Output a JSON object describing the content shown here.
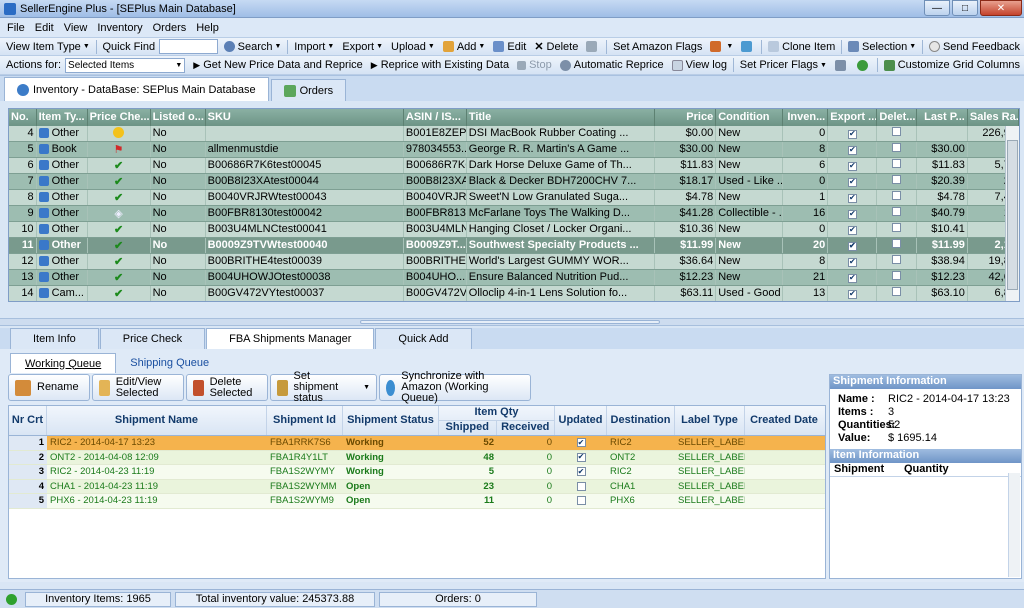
{
  "app": {
    "title": "SellerEngine Plus - [SEPlus Main Database]"
  },
  "menu": [
    "File",
    "Edit",
    "View",
    "Inventory",
    "Orders",
    "Help"
  ],
  "toolbar1": {
    "view_item_type": "View Item Type",
    "quick_find": "Quick Find",
    "search": "Search",
    "import": "Import",
    "export": "Export",
    "upload": "Upload",
    "add": "Add",
    "edit": "Edit",
    "delete": "Delete",
    "set_amazon_flags": "Set Amazon Flags",
    "clone_item": "Clone Item",
    "selection": "Selection",
    "send_feedback": "Send Feedback"
  },
  "toolbar2": {
    "actions_for": "Actions for:",
    "selected_items": "Selected Items",
    "get_new_price": "Get New Price Data and Reprice",
    "reprice_existing": "Reprice with Existing Data",
    "stop": "Stop",
    "automatic_reprice": "Automatic Reprice",
    "view_log": "View log",
    "set_pricer_flags": "Set Pricer Flags",
    "customize_grid": "Customize Grid Columns"
  },
  "main_tabs": [
    "Inventory - DataBase: SEPlus Main Database",
    "Orders"
  ],
  "grid": {
    "headers": [
      "No.",
      "Item Ty...",
      "Price Che...",
      "Listed o...",
      "SKU",
      "ASIN / IS...",
      "Title",
      "Price",
      "Condition",
      "Inven...",
      "Export ...",
      "Delet...",
      "Last P...",
      "Sales Ra..."
    ],
    "rows": [
      {
        "no": "4",
        "type": "Other",
        "icon": "smiley",
        "listed": "No",
        "sku": "",
        "asin": "B001E8ZEPI",
        "title": "DSI MacBook Rubber Coating ...",
        "price": "$0.00",
        "cond": "New",
        "inv": "0",
        "exp": true,
        "del": false,
        "last": "",
        "rank": "226,99"
      },
      {
        "no": "5",
        "type": "Book",
        "icon": "flag",
        "listed": "No",
        "sku": "allmenmustdie",
        "asin": "978034553...",
        "title": "George R. R. Martin's A Game ...",
        "price": "$30.00",
        "cond": "New",
        "inv": "8",
        "exp": true,
        "del": false,
        "last": "$30.00",
        "rank": "1"
      },
      {
        "no": "6",
        "type": "Other",
        "icon": "check",
        "listed": "No",
        "sku": "B00686R7K6test00045",
        "asin": "B00686R7K6",
        "title": "Dark Horse Deluxe Game of Th...",
        "price": "$11.83",
        "cond": "New",
        "inv": "6",
        "exp": true,
        "del": false,
        "last": "$11.83",
        "rank": "5,72"
      },
      {
        "no": "7",
        "type": "Other",
        "icon": "check",
        "listed": "No",
        "sku": "B00B8I23XAtest00044",
        "asin": "B00B8I23XA",
        "title": "Black & Decker BDH7200CHV 7...",
        "price": "$18.17",
        "cond": "Used - Like ...",
        "inv": "0",
        "exp": true,
        "del": false,
        "last": "$20.39",
        "rank": "27"
      },
      {
        "no": "8",
        "type": "Other",
        "icon": "check",
        "listed": "No",
        "sku": "B0040VRJRWtest00043",
        "asin": "B0040VRJRW",
        "title": "Sweet'N Low Granulated Suga...",
        "price": "$4.78",
        "cond": "New",
        "inv": "1",
        "exp": true,
        "del": false,
        "last": "$4.78",
        "rank": "7,45"
      },
      {
        "no": "9",
        "type": "Other",
        "icon": "glass",
        "listed": "No",
        "sku": "B00FBR8130test00042",
        "asin": "B00FBR8130",
        "title": "McFarlane Toys The Walking D...",
        "price": "$41.28",
        "cond": "Collectible - ...",
        "inv": "16",
        "exp": true,
        "del": false,
        "last": "$40.79",
        "rank": "13"
      },
      {
        "no": "10",
        "type": "Other",
        "icon": "check",
        "listed": "No",
        "sku": "B003U4MLNCtest00041",
        "asin": "B003U4MLNC",
        "title": "Hanging Closet / Locker Organi...",
        "price": "$10.36",
        "cond": "New",
        "inv": "0",
        "exp": true,
        "del": false,
        "last": "$10.41",
        "rank": ""
      },
      {
        "no": "11",
        "type": "Other",
        "icon": "check",
        "listed": "No",
        "sku": "B0009Z9TVWtest00040",
        "asin": "B0009Z9T...",
        "title": "Southwest Specialty Products ...",
        "price": "$11.99",
        "cond": "New",
        "inv": "20",
        "exp": true,
        "del": false,
        "last": "$11.99",
        "rank": "2,19"
      },
      {
        "no": "12",
        "type": "Other",
        "icon": "check",
        "listed": "No",
        "sku": "B00BRITHE4test00039",
        "asin": "B00BRITHE4",
        "title": "World's Largest GUMMY WOR...",
        "price": "$36.64",
        "cond": "New",
        "inv": "8",
        "exp": true,
        "del": false,
        "last": "$38.94",
        "rank": "19,81"
      },
      {
        "no": "13",
        "type": "Other",
        "icon": "check",
        "listed": "No",
        "sku": "B004UHOWJOtest00038",
        "asin": "B004UHO...",
        "title": "Ensure Balanced Nutrition Pud...",
        "price": "$12.23",
        "cond": "New",
        "inv": "21",
        "exp": true,
        "del": false,
        "last": "$12.23",
        "rank": "42,68"
      },
      {
        "no": "14",
        "type": "Cam...",
        "icon": "check",
        "listed": "No",
        "sku": "B00GV472VYtest00037",
        "asin": "B00GV472VY",
        "title": "Olloclip 4-in-1 Lens Solution fo...",
        "price": "$63.11",
        "cond": "Used - Good",
        "inv": "13",
        "exp": true,
        "del": false,
        "last": "$63.10",
        "rank": "6,87"
      }
    ]
  },
  "bottom_tabs": [
    "Item Info",
    "Price Check",
    "FBA Shipments Manager",
    "Add Quick"
  ],
  "sub_tabs": [
    "Working Queue",
    "Shipping Queue"
  ],
  "actions": {
    "rename": "Rename",
    "edit_view": "Edit/View Selected",
    "delete_sel": "Delete Selected",
    "set_status": "Set shipment status",
    "sync": "Synchronize with Amazon (Working Queue)"
  },
  "ship_headers": {
    "nr": "Nr Crt",
    "name": "Shipment Name",
    "id": "Shipment Id",
    "status": "Shipment Status",
    "qty": "Item Qty",
    "shipped": "Shipped",
    "received": "Received",
    "updated": "Updated",
    "dest": "Destination",
    "label": "Label Type",
    "created": "Created Date"
  },
  "shipments": [
    {
      "nr": "1",
      "name": "RIC2 - 2014-04-17 13:23",
      "id": "FBA1RRK7S6",
      "status": "Working",
      "shipped": "52",
      "received": "0",
      "updated": true,
      "dest": "RIC2",
      "label": "SELLER_LABEL"
    },
    {
      "nr": "2",
      "name": "ONT2 - 2014-04-08 12:09",
      "id": "FBA1R4Y1LT",
      "status": "Working",
      "shipped": "48",
      "received": "0",
      "updated": true,
      "dest": "ONT2",
      "label": "SELLER_LABEL"
    },
    {
      "nr": "3",
      "name": "RIC2 - 2014-04-23 11:19",
      "id": "FBA1S2WYMY",
      "status": "Working",
      "shipped": "5",
      "received": "0",
      "updated": true,
      "dest": "RIC2",
      "label": "SELLER_LABEL"
    },
    {
      "nr": "4",
      "name": "CHA1 - 2014-04-23 11:19",
      "id": "FBA1S2WYMM",
      "status": "Open",
      "shipped": "23",
      "received": "0",
      "updated": false,
      "dest": "CHA1",
      "label": "SELLER_LABEL"
    },
    {
      "nr": "5",
      "name": "PHX6 - 2014-04-23 11:19",
      "id": "FBA1S2WYM9",
      "status": "Open",
      "shipped": "11",
      "received": "0",
      "updated": false,
      "dest": "PHX6",
      "label": "SELLER_LABEL"
    }
  ],
  "shipment_info": {
    "title": "Shipment Information",
    "name_label": "Name :",
    "name": "RIC2 - 2014-04-17 13:23",
    "items_label": "Items :",
    "items": "3",
    "quantities_label": "Quantities:",
    "quantities": "52",
    "value_label": "Value:",
    "value": "$ 1695.14",
    "item_info_title": "Item Information",
    "col_shipment": "Shipment",
    "col_quantity": "Quantity"
  },
  "status": {
    "inventory_items": "Inventory Items: 1965",
    "total_value": "Total inventory value: 245373.88",
    "orders": "Orders: 0"
  },
  "colors": {
    "grid_head": "#6d9486",
    "grid_row_odd": "#c5d9d1",
    "grid_row_even": "#9dbdb1",
    "ship_sel": "#f5b34d",
    "ship_green": "#1a7a1a"
  }
}
